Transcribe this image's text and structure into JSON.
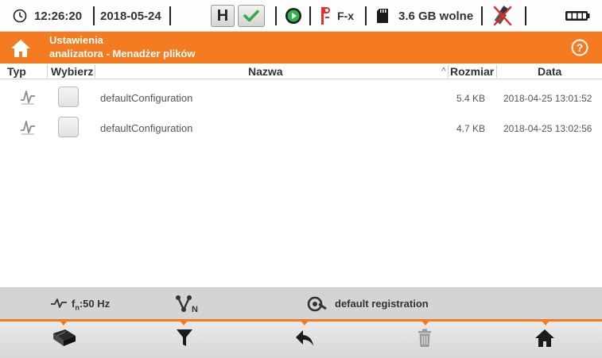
{
  "statusbar": {
    "clock_icon": "clock-icon",
    "time": "12:26:20",
    "date": "2018-05-24",
    "hold_label": "H",
    "ok_icon": "check-icon",
    "play_icon": "play-circle-icon",
    "clamp_icon": "clamp-icon",
    "clamp_label": "F-x",
    "sd_icon": "sd-card-icon",
    "storage_label": "3.6 GB wolne",
    "usb_icon": "usb-disconnected-icon",
    "battery_icon": "battery-icon"
  },
  "titlebar": {
    "home_icon": "home-icon",
    "line1": "Ustawienia",
    "line2": "analizatora - Menadżer plików",
    "help_icon": "help-icon",
    "accent_color": "#f47b20"
  },
  "table": {
    "headers": {
      "type": "Typ",
      "select": "Wybierz",
      "name": "Nazwa",
      "sort_marker": "^",
      "size": "Rozmiar",
      "date": "Data"
    },
    "rows": [
      {
        "type_icon": "waveform-file-icon",
        "name": "defaultConfiguration",
        "size": "5.4 KB",
        "date": "2018-04-25 13:01:52"
      },
      {
        "type_icon": "waveform-file-icon",
        "name": "defaultConfiguration",
        "size": "4.7 KB",
        "date": "2018-04-25 13:02:56"
      }
    ]
  },
  "infobar": {
    "frequency_label": "f",
    "frequency_sub": "n",
    "frequency_value": ":50 Hz",
    "network_icon": "network-type-icon",
    "network_sub": "N",
    "registration_icon": "registration-icon",
    "registration_label": "default registration"
  },
  "toolbar": {
    "buttons": [
      {
        "name": "memory-button",
        "icon": "memory-card-icon"
      },
      {
        "name": "filter-button",
        "icon": "filter-icon"
      },
      {
        "name": "back-button",
        "icon": "back-arrow-icon"
      },
      {
        "name": "delete-button",
        "icon": "trash-icon"
      },
      {
        "name": "home-button",
        "icon": "home-icon"
      }
    ]
  }
}
